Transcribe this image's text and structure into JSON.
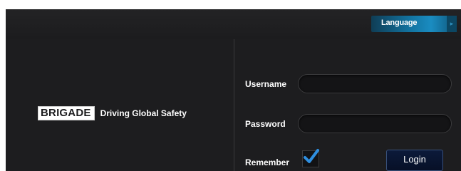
{
  "header": {
    "language_label": "Language"
  },
  "branding": {
    "logo_text": "BRIGADE",
    "tagline": "Driving Global Safety"
  },
  "login_form": {
    "username_label": "Username",
    "username_value": "",
    "password_label": "Password",
    "password_value": "",
    "remember_label": "Remember",
    "remember_checked": true,
    "login_button": "Login"
  },
  "icons": {
    "checkmark": "checkmark-icon",
    "language_caret": "chevron-right-icon"
  },
  "colors": {
    "background": "#1d1d1f",
    "accent": "#1a8cc1",
    "checkmark": "#2f8fe0"
  }
}
